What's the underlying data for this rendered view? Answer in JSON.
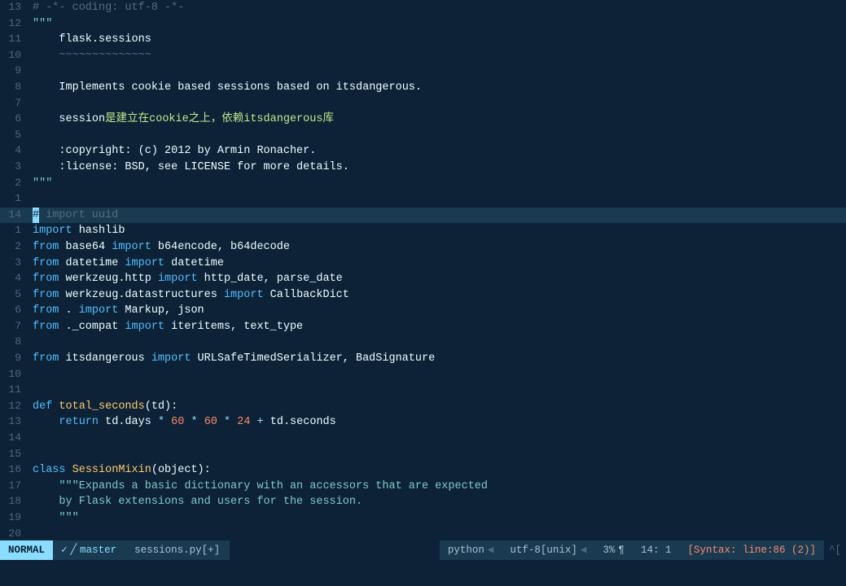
{
  "editor": {
    "lines": [
      {
        "num": "13",
        "highlight": false,
        "tokens": [
          {
            "cls": "kw-comment",
            "text": "# -*- coding: utf-8 -*-"
          }
        ]
      },
      {
        "num": "12",
        "highlight": false,
        "tokens": [
          {
            "cls": "kw-docstr",
            "text": "\"\"\""
          }
        ]
      },
      {
        "num": "11",
        "highlight": false,
        "tokens": [
          {
            "cls": "kw-white",
            "text": "    flask.sessions"
          }
        ]
      },
      {
        "num": "10",
        "highlight": false,
        "tokens": [
          {
            "cls": "kw-tilde",
            "text": "    ~~~~~~~~~~~~~~"
          }
        ]
      },
      {
        "num": "9",
        "highlight": false,
        "tokens": []
      },
      {
        "num": "8",
        "highlight": false,
        "tokens": [
          {
            "cls": "kw-white",
            "text": "    Implements cookie "
          },
          {
            "cls": "kw-white",
            "text": "based"
          },
          {
            "cls": "kw-white",
            "text": " sessions "
          },
          {
            "cls": "kw-white",
            "text": "based"
          },
          {
            "cls": "kw-white",
            "text": " on itsdangerous."
          }
        ]
      },
      {
        "num": "7",
        "highlight": false,
        "tokens": []
      },
      {
        "num": "6",
        "highlight": false,
        "tokens": [
          {
            "cls": "kw-white",
            "text": "    session"
          },
          {
            "cls": "kw-chinese",
            "text": "是建立在cookie之上，依赖itsdangerous库"
          }
        ]
      },
      {
        "num": "5",
        "highlight": false,
        "tokens": []
      },
      {
        "num": "4",
        "highlight": false,
        "tokens": [
          {
            "cls": "kw-white",
            "text": "    :copyright: (c) 2012 by Armin Ronacher."
          }
        ]
      },
      {
        "num": "3",
        "highlight": false,
        "tokens": [
          {
            "cls": "kw-white",
            "text": "    :license: BSD, see LICENSE for more details."
          }
        ]
      },
      {
        "num": "2",
        "highlight": false,
        "tokens": [
          {
            "cls": "kw-docstr",
            "text": "\"\"\""
          }
        ]
      },
      {
        "num": "1",
        "highlight": false,
        "tokens": []
      },
      {
        "num": "14",
        "highlight": true,
        "tokens": [
          {
            "cls": "cursor-wrap",
            "text": ""
          },
          {
            "cls": "kw-comment",
            "text": " import uuid"
          }
        ]
      },
      {
        "num": "1",
        "highlight": false,
        "tokens": [
          {
            "cls": "kw-blue",
            "text": "import"
          },
          {
            "cls": "kw-white",
            "text": " hashlib"
          }
        ]
      },
      {
        "num": "2",
        "highlight": false,
        "tokens": [
          {
            "cls": "kw-blue",
            "text": "from"
          },
          {
            "cls": "kw-white",
            "text": " base64 "
          },
          {
            "cls": "kw-blue",
            "text": "import"
          },
          {
            "cls": "kw-white",
            "text": " b64encode, b64decode"
          }
        ]
      },
      {
        "num": "3",
        "highlight": false,
        "tokens": [
          {
            "cls": "kw-blue",
            "text": "from"
          },
          {
            "cls": "kw-white",
            "text": " datetime "
          },
          {
            "cls": "kw-blue",
            "text": "import"
          },
          {
            "cls": "kw-white",
            "text": " datetime"
          }
        ]
      },
      {
        "num": "4",
        "highlight": false,
        "tokens": [
          {
            "cls": "kw-blue",
            "text": "from"
          },
          {
            "cls": "kw-white",
            "text": " werkzeug.http "
          },
          {
            "cls": "kw-blue",
            "text": "import"
          },
          {
            "cls": "kw-white",
            "text": " http_date, parse_date"
          }
        ]
      },
      {
        "num": "5",
        "highlight": false,
        "tokens": [
          {
            "cls": "kw-blue",
            "text": "from"
          },
          {
            "cls": "kw-white",
            "text": " werkzeug.datastructures "
          },
          {
            "cls": "kw-blue",
            "text": "import"
          },
          {
            "cls": "kw-white",
            "text": " CallbackDict"
          }
        ]
      },
      {
        "num": "6",
        "highlight": false,
        "tokens": [
          {
            "cls": "kw-blue",
            "text": "from"
          },
          {
            "cls": "kw-white",
            "text": " . "
          },
          {
            "cls": "kw-blue",
            "text": "import"
          },
          {
            "cls": "kw-white",
            "text": " Markup, json"
          }
        ]
      },
      {
        "num": "7",
        "highlight": false,
        "tokens": [
          {
            "cls": "kw-blue",
            "text": "from"
          },
          {
            "cls": "kw-white",
            "text": " ._compat "
          },
          {
            "cls": "kw-blue",
            "text": "import"
          },
          {
            "cls": "kw-white",
            "text": " iteritems, text_type"
          }
        ]
      },
      {
        "num": "8",
        "highlight": false,
        "tokens": []
      },
      {
        "num": "9",
        "highlight": false,
        "tokens": [
          {
            "cls": "kw-blue",
            "text": "from"
          },
          {
            "cls": "kw-white",
            "text": " itsdangerous "
          },
          {
            "cls": "kw-blue",
            "text": "import"
          },
          {
            "cls": "kw-white",
            "text": " URLSafeTimedSerializer, BadSignature"
          }
        ]
      },
      {
        "num": "10",
        "highlight": false,
        "tokens": []
      },
      {
        "num": "11",
        "highlight": false,
        "tokens": []
      },
      {
        "num": "12",
        "highlight": false,
        "tokens": [
          {
            "cls": "kw-blue",
            "text": "def"
          },
          {
            "cls": "kw-white",
            "text": " "
          },
          {
            "cls": "kw-yellow",
            "text": "total_seconds"
          },
          {
            "cls": "kw-white",
            "text": "(td):"
          }
        ]
      },
      {
        "num": "13",
        "highlight": false,
        "tokens": [
          {
            "cls": "kw-white",
            "text": "    "
          },
          {
            "cls": "kw-blue",
            "text": "return"
          },
          {
            "cls": "kw-white",
            "text": " td.days "
          },
          {
            "cls": "kw-green",
            "text": "*"
          },
          {
            "cls": "kw-white",
            "text": " "
          },
          {
            "cls": "kw-orange",
            "text": "60"
          },
          {
            "cls": "kw-white",
            "text": " "
          },
          {
            "cls": "kw-green",
            "text": "*"
          },
          {
            "cls": "kw-white",
            "text": " "
          },
          {
            "cls": "kw-orange",
            "text": "60"
          },
          {
            "cls": "kw-white",
            "text": " "
          },
          {
            "cls": "kw-green",
            "text": "*"
          },
          {
            "cls": "kw-white",
            "text": " "
          },
          {
            "cls": "kw-orange",
            "text": "24"
          },
          {
            "cls": "kw-white",
            "text": " "
          },
          {
            "cls": "kw-green",
            "text": "+"
          },
          {
            "cls": "kw-white",
            "text": " td.seconds"
          }
        ]
      },
      {
        "num": "14",
        "highlight": false,
        "tokens": []
      },
      {
        "num": "15",
        "highlight": false,
        "tokens": []
      },
      {
        "num": "16",
        "highlight": false,
        "tokens": [
          {
            "cls": "kw-blue",
            "text": "class"
          },
          {
            "cls": "kw-white",
            "text": " "
          },
          {
            "cls": "kw-yellow",
            "text": "SessionMixin"
          },
          {
            "cls": "kw-white",
            "text": "(object):"
          }
        ]
      },
      {
        "num": "17",
        "highlight": false,
        "tokens": [
          {
            "cls": "kw-white",
            "text": "    "
          },
          {
            "cls": "kw-docstr",
            "text": "\"\"\"Expands a basic dictionary with an accessors that are expected"
          }
        ]
      },
      {
        "num": "18",
        "highlight": false,
        "tokens": [
          {
            "cls": "kw-docstr",
            "text": "    by Flask extensions and users for the session."
          }
        ]
      },
      {
        "num": "19",
        "highlight": false,
        "tokens": [
          {
            "cls": "kw-white",
            "text": "    "
          },
          {
            "cls": "kw-docstr",
            "text": "\"\"\""
          }
        ]
      },
      {
        "num": "20",
        "highlight": false,
        "tokens": []
      }
    ]
  },
  "statusbar": {
    "mode": "NORMAL",
    "branch_icon": "✓",
    "branch": "master",
    "file": "sessions.py[+]",
    "filetype": "python",
    "filetype_arrow": "◀",
    "encoding": "utf-8[unix]",
    "encoding_arrow": "◀",
    "percent": "3%",
    "pilcrow": "¶",
    "position": "14:   1",
    "syntax": "[Syntax: line:86 (2)]",
    "caret": "^["
  }
}
